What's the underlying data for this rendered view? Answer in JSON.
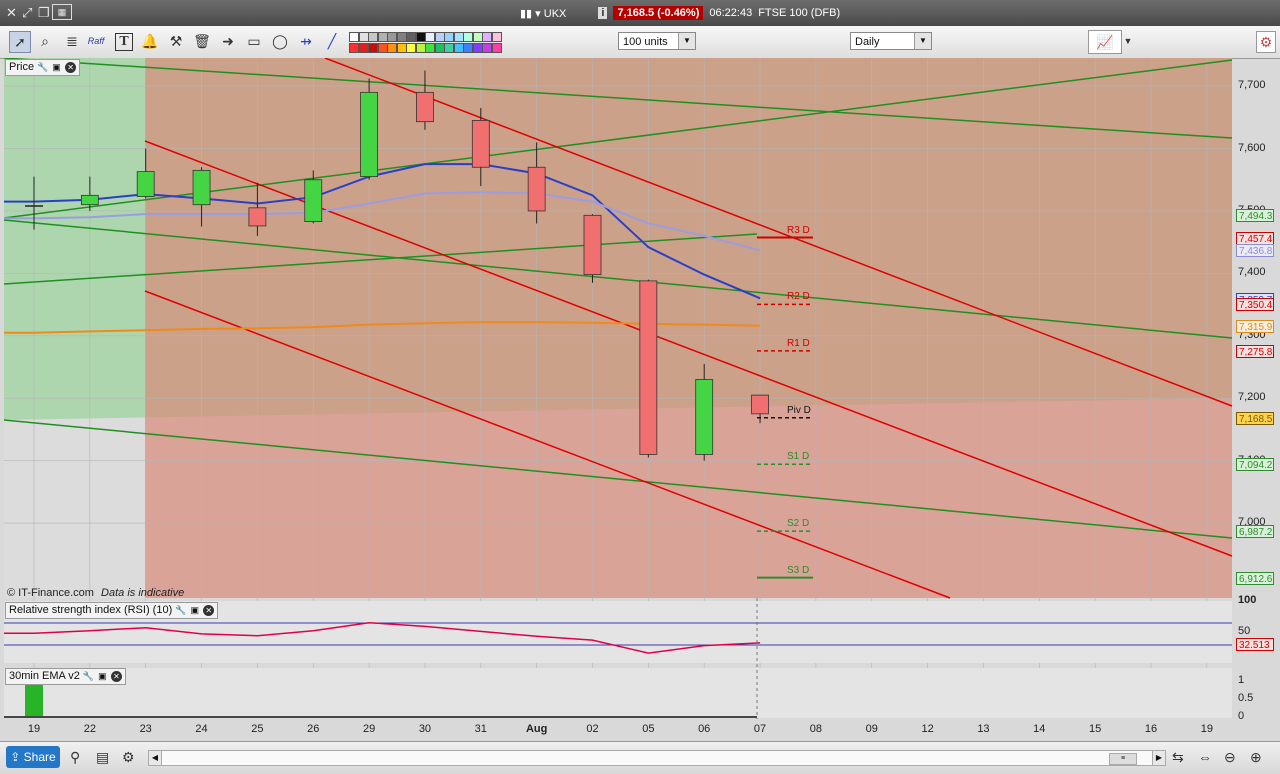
{
  "window": {
    "instrument": "UKX",
    "price": "7,168.5 (-0.46%)",
    "time": "06:22:43",
    "market": "FTSE 100 (DFB)"
  },
  "toolbar": {
    "units": "100 units",
    "interval": "Daily",
    "raff_label": "Raff"
  },
  "panels": {
    "price": "Price",
    "rsi": "Relative strength index (RSI) (10)",
    "ema": "30min EMA v2"
  },
  "copyright": "© IT-Finance.com",
  "disclaimer": "Data is indicative",
  "axis": {
    "price_ticks": [
      "7,700",
      "7,600",
      "7,500",
      "7,400",
      "7,300",
      "7,200",
      "7,100",
      "7,000"
    ],
    "rsi_ticks": [
      "100",
      "50"
    ],
    "ema_ticks": [
      "1",
      "0.5",
      "0"
    ]
  },
  "price_tags": [
    {
      "label": "7,494.3",
      "color": "#2e8b2e",
      "bg": "#d9f0d9"
    },
    {
      "label": "7,457.4",
      "color": "#d00000",
      "bg": "#fbe0e0"
    },
    {
      "label": "7,436.8",
      "color": "#8c8cd0",
      "bg": "#ebebf8"
    },
    {
      "label": "7,359.7",
      "color": "#2a3fc8",
      "bg": "#e0e4fa"
    },
    {
      "label": "7,350.4",
      "color": "#d00000",
      "bg": "#fbe0e0"
    },
    {
      "label": "7,315.9",
      "color": "#e08a1a",
      "bg": "#fbeedd"
    },
    {
      "label": "7,275.8",
      "color": "#d00000",
      "bg": "#fbe0e0"
    },
    {
      "label": "7,168.8",
      "color": "#333333",
      "bg": "#f0f0f0"
    },
    {
      "label": "7,168.5",
      "color": "#7a5a00",
      "bg": "#ffd24d"
    },
    {
      "label": "7,094.2",
      "color": "#2e8b2e",
      "bg": "#d9f0d9"
    },
    {
      "label": "6,987.2",
      "color": "#2e8b2e",
      "bg": "#d9f0d9"
    },
    {
      "label": "6,912.6",
      "color": "#2e8b2e",
      "bg": "#d9f0d9"
    }
  ],
  "rsi_value": "32.513",
  "pivots": [
    {
      "label": "R3 D",
      "value": 7457.4,
      "color": "#d00000"
    },
    {
      "label": "R2 D",
      "value": 7350.4,
      "color": "#d00000"
    },
    {
      "label": "R1 D",
      "value": 7275.8,
      "color": "#d00000"
    },
    {
      "label": "Piv D",
      "value": 7168.8,
      "color": "#111111"
    },
    {
      "label": "S1 D",
      "value": 7094.2,
      "color": "#2e8b2e"
    },
    {
      "label": "S2 D",
      "value": 6987.2,
      "color": "#2e8b2e"
    },
    {
      "label": "S3 D",
      "value": 6912.6,
      "color": "#2e8b2e"
    }
  ],
  "dates": [
    "19",
    "22",
    "23",
    "24",
    "25",
    "26",
    "29",
    "30",
    "31",
    "Aug",
    "02",
    "05",
    "06",
    "07",
    "08",
    "09",
    "12",
    "13",
    "14",
    "15",
    "16",
    "19"
  ],
  "chart_data": {
    "type": "candlestick",
    "y_range": [
      6880,
      7745
    ],
    "candles": [
      {
        "date": "19",
        "open": 7508,
        "high": 7555,
        "low": 7470,
        "close": 7508
      },
      {
        "date": "22",
        "open": 7510,
        "high": 7555,
        "low": 7500,
        "close": 7525
      },
      {
        "date": "23",
        "open": 7523,
        "high": 7600,
        "low": 7520,
        "close": 7563
      },
      {
        "date": "24",
        "open": 7510,
        "high": 7570,
        "low": 7475,
        "close": 7565
      },
      {
        "date": "25",
        "open": 7505,
        "high": 7545,
        "low": 7460,
        "close": 7476
      },
      {
        "date": "26",
        "open": 7483,
        "high": 7565,
        "low": 7480,
        "close": 7550
      },
      {
        "date": "29",
        "open": 7555,
        "high": 7712,
        "low": 7550,
        "close": 7690
      },
      {
        "date": "30",
        "open": 7690,
        "high": 7725,
        "low": 7630,
        "close": 7643
      },
      {
        "date": "31",
        "open": 7645,
        "high": 7665,
        "low": 7540,
        "close": 7570
      },
      {
        "date": "Aug",
        "open": 7570,
        "high": 7610,
        "low": 7480,
        "close": 7500
      },
      {
        "date": "02",
        "open": 7493,
        "high": 7495,
        "low": 7385,
        "close": 7398
      },
      {
        "date": "05",
        "open": 7388,
        "high": 7390,
        "low": 7105,
        "close": 7110
      },
      {
        "date": "06",
        "open": 7110,
        "high": 7255,
        "low": 7100,
        "close": 7230
      },
      {
        "date": "07",
        "open": 7205,
        "high": 7205,
        "low": 7160,
        "close": 7175
      }
    ],
    "series": [
      {
        "name": "blue",
        "color": "#2a3fc8",
        "values": [
          7515,
          7518,
          7527,
          7520,
          7512,
          7522,
          7555,
          7575,
          7575,
          7560,
          7525,
          7442,
          7398,
          7360
        ]
      },
      {
        "name": "lavender",
        "color": "#9c9ce0",
        "values": [
          7488,
          7490,
          7495,
          7495,
          7495,
          7497,
          7512,
          7528,
          7530,
          7528,
          7515,
          7480,
          7460,
          7437
        ]
      },
      {
        "name": "orange",
        "color": "#f08a1a",
        "values": [
          7305,
          7307,
          7309,
          7311,
          7312,
          7314,
          7318,
          7320,
          7322,
          7322,
          7321,
          7319,
          7318,
          7316
        ]
      }
    ],
    "rsi": {
      "range": [
        0,
        100
      ],
      "values": [
        48,
        52,
        57,
        47,
        44,
        52,
        65,
        59,
        51,
        43,
        37,
        16,
        28,
        32.5
      ]
    }
  }
}
